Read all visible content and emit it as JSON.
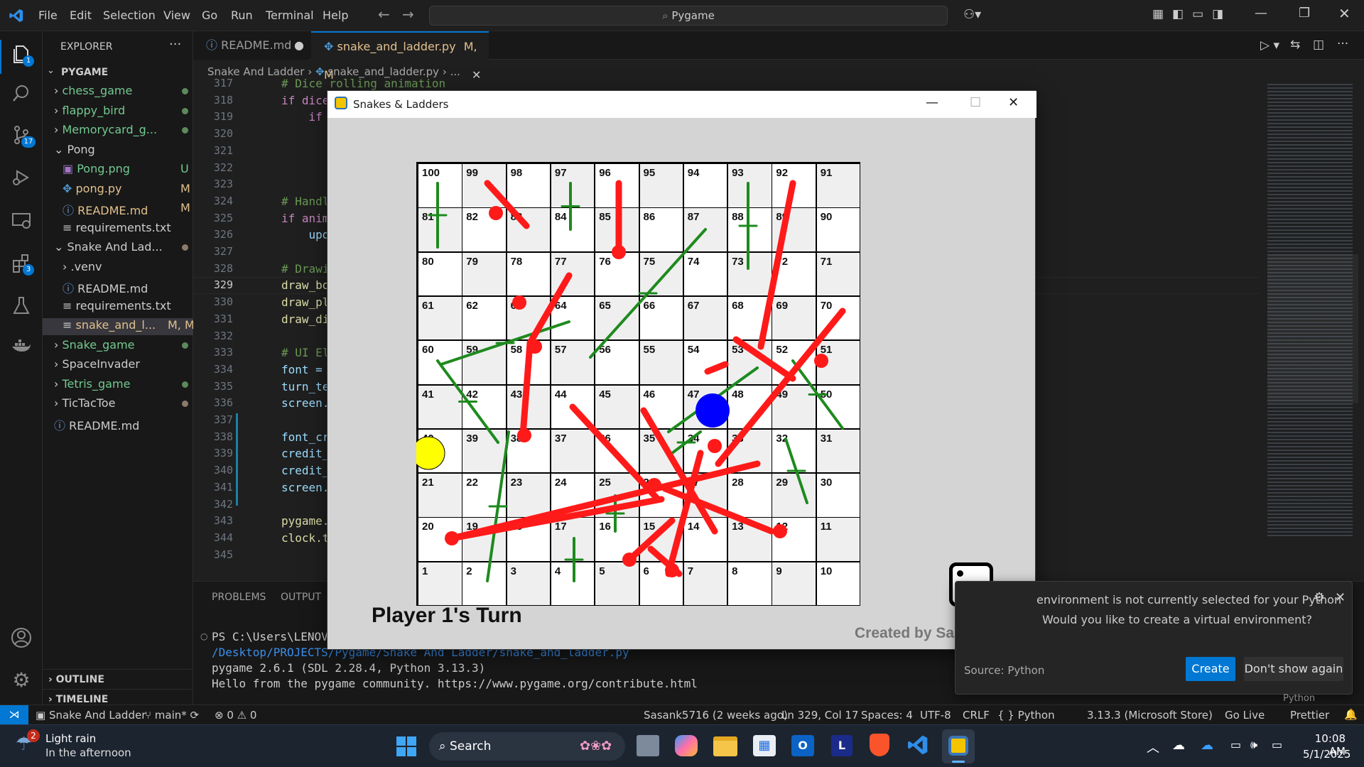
{
  "menu": [
    "File",
    "Edit",
    "Selection",
    "View",
    "Go",
    "Run",
    "Terminal",
    "Help"
  ],
  "command_center": "Pygame",
  "explorer": {
    "title": "EXPLORER",
    "root": "PYGAME",
    "items": [
      {
        "label": "chess_game",
        "type": "folder",
        "status": ""
      },
      {
        "label": "flappy_bird",
        "type": "folder",
        "status": ""
      },
      {
        "label": "Memorycard_g...",
        "type": "folder",
        "status": ""
      },
      {
        "label": "Pong",
        "type": "folder-open",
        "status": ""
      },
      {
        "label": "Pong.png",
        "type": "file",
        "status": "U"
      },
      {
        "label": "pong.py",
        "type": "file",
        "status": "M"
      },
      {
        "label": "README.md",
        "type": "file",
        "status": "M"
      },
      {
        "label": "requirements.txt",
        "type": "file",
        "status": ""
      },
      {
        "label": "Snake And Lad...",
        "type": "folder-open",
        "status": ""
      },
      {
        "label": ".venv",
        "type": "folder",
        "status": ""
      },
      {
        "label": "README.md",
        "type": "file",
        "status": ""
      },
      {
        "label": "requirements.txt",
        "type": "file",
        "status": ""
      },
      {
        "label": "snake_and_l...",
        "type": "file",
        "status": "M, M"
      },
      {
        "label": "Snake_game",
        "type": "folder",
        "status": ""
      },
      {
        "label": "SpaceInvader",
        "type": "folder",
        "status": ""
      },
      {
        "label": "Tetris_game",
        "type": "folder",
        "status": ""
      },
      {
        "label": "TicTacToe",
        "type": "folder",
        "status": ""
      },
      {
        "label": "README.md",
        "type": "file",
        "status": ""
      }
    ],
    "outline": "OUTLINE",
    "timeline": "TIMELINE"
  },
  "activity_badges": {
    "explorer": "1",
    "source_control": "17",
    "extensions": "3"
  },
  "tabs": [
    {
      "label": "README.md",
      "state": "●"
    },
    {
      "label": "snake_and_ladder.py",
      "state": "M, M"
    }
  ],
  "breadcrumb": [
    "Snake And Ladder",
    "snake_and_ladder.py",
    "..."
  ],
  "line_numbers": [
    "317",
    "318",
    "319",
    "320",
    "321",
    "322",
    "323",
    "324",
    "325",
    "326",
    "327",
    "328",
    "329",
    "330",
    "331",
    "332",
    "333",
    "334",
    "335",
    "336",
    "337",
    "338",
    "339",
    "340",
    "341",
    "342",
    "343",
    "344",
    "345"
  ],
  "code_lines": [
    "# Dice rolling animation",
    "if dice",
    "    if",
    "",
    "",
    "",
    "",
    "# Handl",
    "if anim",
    "    upd",
    "",
    "# Drawi",
    "draw_bo",
    "draw_pl",
    "draw_di",
    "",
    "# UI El",
    "font =",
    "turn_te",
    "screen.",
    "",
    "font_cr",
    "credit_",
    "credit_",
    "screen.",
    "",
    "pygame.",
    "clock.t",
    ""
  ],
  "panel": {
    "tabs": [
      "PROBLEMS",
      "OUTPUT"
    ],
    "terminal": [
      "PS C:\\Users\\LENOVO",
      "/Desktop/PROJECTS/Pygame/Snake And Ladder/snake_and_ladder.py",
      "pygame 2.6.1 (SDL 2.28.4, Python 3.13.3)",
      "Hello from the pygame community. https://www.pygame.org/contribute.html"
    ]
  },
  "game": {
    "title": "Snakes & Ladders",
    "turn": "Player 1's Turn",
    "credit": "Created by Sasank Lama",
    "dice_value": 2,
    "cells": [
      "91",
      "92",
      "93",
      "94",
      "95",
      "96",
      "97",
      "98",
      "99",
      "100",
      "90",
      "89",
      "87",
      "86",
      "85",
      "84",
      "83",
      "81",
      "71",
      "72",
      "73",
      "74",
      "75",
      "76",
      "77",
      "78",
      "79",
      "80",
      "70",
      "69",
      "66",
      "65",
      "64",
      "63",
      "62",
      "61",
      "51",
      "53",
      "54",
      "55",
      "56",
      "57",
      "5",
      "50",
      "49",
      "48",
      "47",
      "46",
      "45",
      "44",
      "43",
      "42",
      "41",
      "32",
      "33",
      "34",
      "35",
      "36",
      "37",
      "38",
      "39",
      "40",
      "30",
      "29",
      "28",
      "27",
      "26",
      "23",
      "22",
      "21",
      "11",
      "12",
      "13",
      "15",
      "16",
      "17",
      "18",
      "9",
      "20",
      "10",
      "9",
      "8",
      "7",
      "6",
      "5",
      "4",
      "3",
      "2",
      "1"
    ]
  },
  "notification": {
    "line1": "environment is not currently selected for your Python",
    "line2": "Would you like to create a virtual environment?",
    "source": "Source: Python",
    "create": "Create",
    "dismiss": "Don't show again"
  },
  "statusbar": {
    "left": [
      "Snake And Ladder",
      "main*",
      "⊗ 0 ⚠ 0"
    ],
    "right": [
      "Sasank5716 (2 weeks ago)",
      "Ln 329, Col 17",
      "Spaces: 4",
      "UTF-8",
      "CRLF",
      "{ } Python",
      "3.13.3 (Microsoft Store)",
      "Go Live",
      "Prettier"
    ]
  },
  "taskbar": {
    "weather_title": "Light rain",
    "weather_sub": "In the afternoon",
    "weather_badge": "2",
    "search": "Search",
    "time": "10:08 AM",
    "date": "5/1/2025"
  },
  "minimap_lang": "Python"
}
